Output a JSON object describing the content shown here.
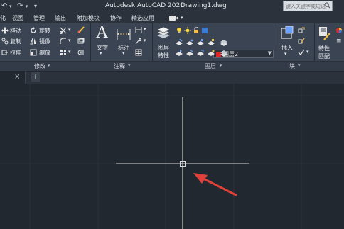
{
  "titlebar": {
    "app_title": "Autodesk AutoCAD 2020",
    "file_name": "Drawing1.dwg",
    "search_placeholder": "键入关键字或短语"
  },
  "menubar": {
    "items": [
      "化",
      "视图",
      "管理",
      "输出",
      "附加模块",
      "协作",
      "精选应用"
    ]
  },
  "ribbon": {
    "modify": {
      "move": "移动",
      "rotate": "旋转",
      "copy": "复制",
      "mirror": "镜像",
      "stretch": "拉伸",
      "scale": "缩放",
      "panel_title": "修改"
    },
    "annotation": {
      "text": "文字",
      "dimension": "标注",
      "panel_title": "注释"
    },
    "layers": {
      "layer_props_line1": "图层",
      "layer_props_line2": "特性",
      "current_layer": "图层2",
      "panel_title": "图层"
    },
    "block": {
      "insert": "插入",
      "panel_title": "块"
    },
    "properties": {
      "match_line1": "特性",
      "match_line2": "匹配"
    }
  },
  "tabs": {
    "close": "×",
    "add": "+"
  },
  "colors": {
    "background": "#212830",
    "ribbon": "#3b4453",
    "layer_swatch": "#e0262a",
    "arrow": "#e0403a",
    "crosshair": "#d8d8d8"
  }
}
